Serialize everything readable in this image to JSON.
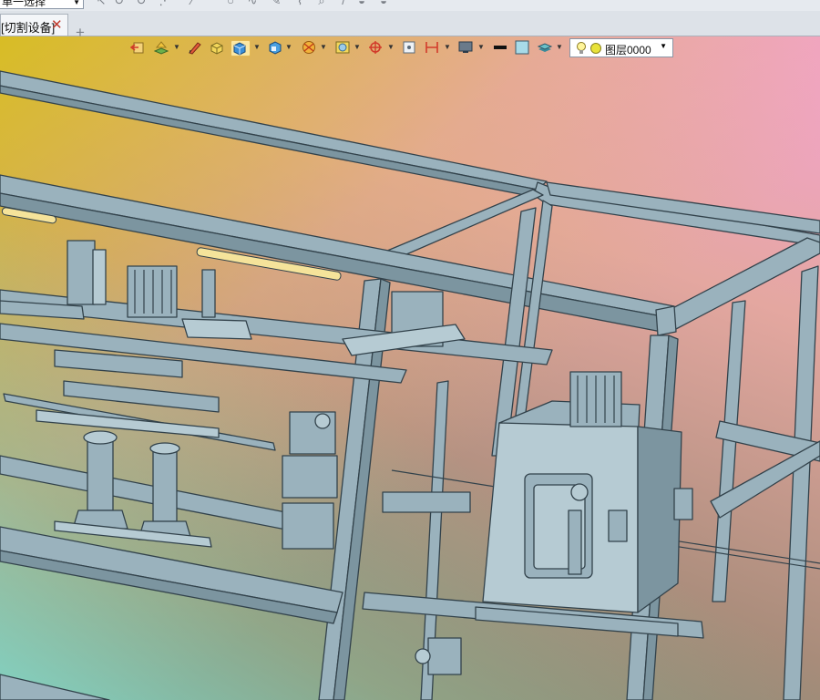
{
  "toolbar": {
    "selection_mode": "单一选择",
    "icons": [
      "pointer-icon",
      "rotate-icon",
      "redo-icon",
      "dotted-arrow-icon",
      "line-icon",
      "arc-icon",
      "circle-icon",
      "spline-icon",
      "pen-icon",
      "polyline-icon",
      "zoom-icon",
      "shade-icon"
    ]
  },
  "tabs": [
    {
      "label": "[切割设备]",
      "close": "✕"
    }
  ],
  "new_tab_label": "+",
  "view_toolbar": {
    "buttons": [
      "exit-view-icon",
      "layer-view-icon",
      "pencil-icon",
      "eraser-cube-icon",
      "shaded-cube-icon",
      "view-orientation-icon",
      "section-view-icon",
      "measure-icon",
      "snap-icon",
      "pin-icon",
      "dimension-icon",
      "display-icon",
      "line-color-icon",
      "fill-color-icon",
      "layers-stack-icon"
    ],
    "layer": {
      "name": "图层0000",
      "color": "#e8e23a"
    }
  },
  "colors": {
    "steel": "#9ab2bd",
    "steel_dark": "#7c95a0",
    "steel_edge": "#32424b",
    "accent_active": "#fbe7a2"
  }
}
